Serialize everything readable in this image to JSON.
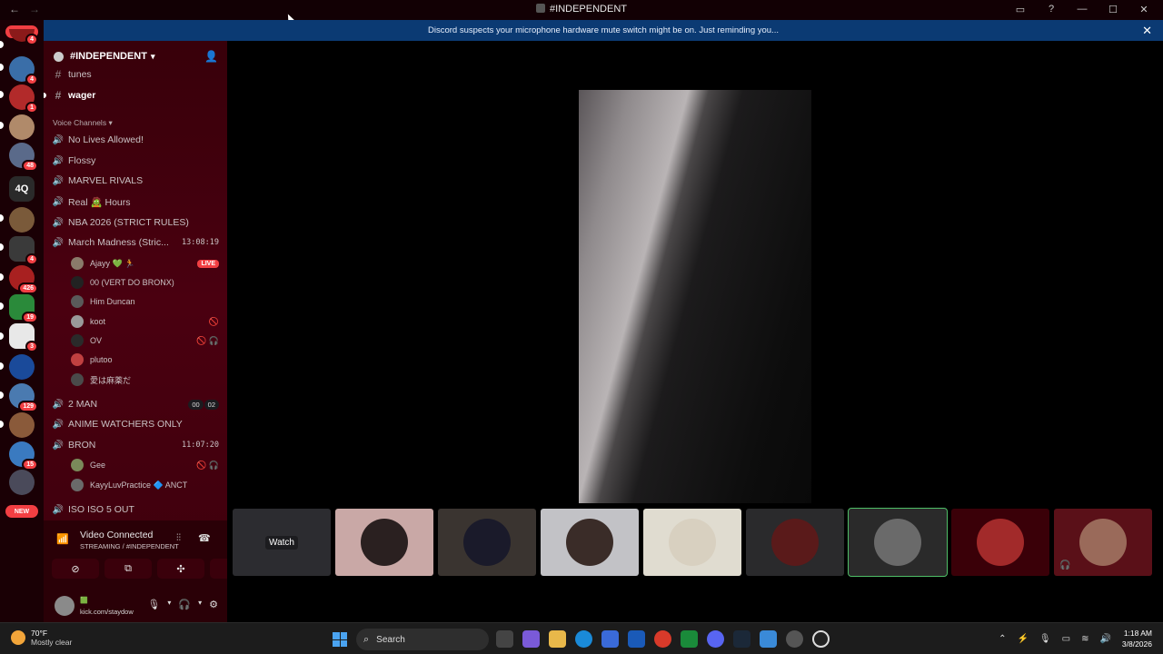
{
  "window": {
    "title": "#INDEPENDENT",
    "back": "←",
    "forward": "→"
  },
  "notice": {
    "text": "Discord suspects your microphone hardware mute switch might be on. Just reminding you...",
    "close": "✕"
  },
  "rail": {
    "new_top": "NEW",
    "new_bottom": "NEW",
    "quick_server": "4Q",
    "badges": [
      "4",
      "4",
      "1",
      "48",
      "4",
      "426",
      "19",
      "3",
      "129",
      "15"
    ]
  },
  "server": {
    "name": "#INDEPENDENT",
    "text_channels": [
      {
        "name": "tunes",
        "unread": false
      },
      {
        "name": "wager",
        "unread": true
      }
    ],
    "voice_category": "Voice Channels",
    "voice_channels": [
      {
        "name": "No Lives Allowed!",
        "timer": "",
        "counts": []
      },
      {
        "name": "Flossy",
        "timer": "",
        "counts": []
      },
      {
        "name": "MARVEL RIVALS",
        "timer": "",
        "counts": []
      },
      {
        "name": "Real 🧟 Hours",
        "timer": "",
        "counts": []
      },
      {
        "name": "NBA 2026 (STRICT RULES)",
        "timer": "",
        "counts": []
      },
      {
        "name": "March Madness (Stric...",
        "timer": "13:08:19",
        "counts": []
      },
      {
        "name": "2 MAN",
        "timer": "",
        "counts": [
          "00",
          "02"
        ]
      },
      {
        "name": "ANIME WATCHERS ONLY",
        "timer": "",
        "counts": []
      },
      {
        "name": "BRON",
        "timer": "11:07:20",
        "counts": []
      },
      {
        "name": "ISO ISO 5 OUT",
        "timer": "",
        "counts": []
      }
    ],
    "march_users": [
      {
        "name": "Ajayy 💚 🏃",
        "tag": "LIVE",
        "icons": ""
      },
      {
        "name": "00 (VERT DO BRONX)",
        "tag": "",
        "icons": ""
      },
      {
        "name": "Him Duncan",
        "tag": "",
        "icons": ""
      },
      {
        "name": "koot",
        "tag": "",
        "icons": "🚫"
      },
      {
        "name": "OV",
        "tag": "",
        "icons": "🚫 🎧"
      },
      {
        "name": "plutoo",
        "tag": "",
        "icons": ""
      },
      {
        "name": "愛は麻薬だ",
        "tag": "",
        "icons": ""
      }
    ],
    "bron_users": [
      {
        "name": "Gee",
        "tag": "",
        "icons": "🚫 🎧"
      },
      {
        "name": "KayyLuvPractice 🔷 ANCT",
        "tag": "",
        "icons": ""
      }
    ]
  },
  "voice_panel": {
    "status": "Video Connected",
    "sub": "STREAMING / #INDEPENDENT",
    "user_status": "🟩",
    "user_link": "kick.com/staydow"
  },
  "stage": {
    "watch_label": "Watch"
  },
  "taskbar": {
    "temperature": "70°F",
    "conditions": "Mostly clear",
    "search_placeholder": "Search",
    "time": "1:18 AM",
    "date": "3/8/2026"
  },
  "colors": {
    "accent_red": "#f23f43",
    "notice_blue": "#0b3a73",
    "sidebar_bg": "#4a0010",
    "connected_green": "#2db34a"
  }
}
